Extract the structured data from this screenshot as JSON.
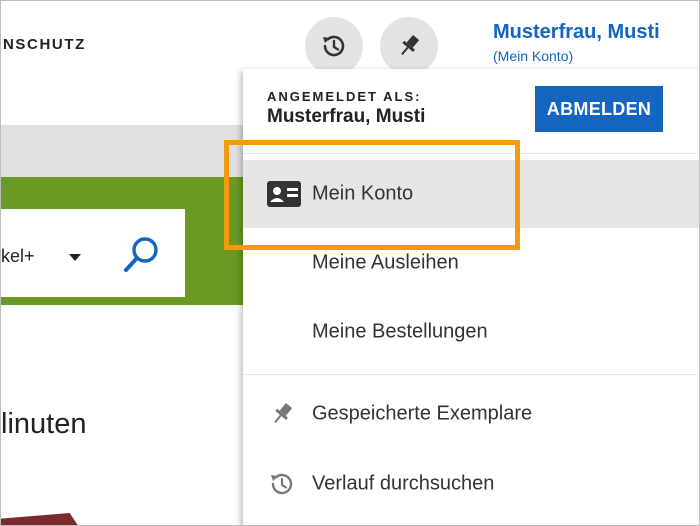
{
  "header": {
    "brand_fragment": "NSCHUTZ",
    "history_button_icon": "history-icon",
    "pin_button_icon": "pin-icon",
    "user_name": "Musterfrau, Musti",
    "account_link": "(Mein Konto)"
  },
  "search": {
    "type_fragment": "kel+",
    "search_icon": "search-icon"
  },
  "main": {
    "heading_fragment": "linuten"
  },
  "account_menu": {
    "signed_in_label": "ANGEMELDET ALS:",
    "signed_in_name": "Musterfrau, Musti",
    "logout_label": "ABMELDEN",
    "items": [
      {
        "label": "Mein Konto",
        "icon": "id-card-icon",
        "active": true
      },
      {
        "label": "Meine Ausleihen",
        "icon": "",
        "active": false
      },
      {
        "label": "Meine Bestellungen",
        "icon": "",
        "active": false
      },
      {
        "label": "Gespeicherte Exemplare",
        "icon": "pin-icon",
        "active": false
      },
      {
        "label": "Verlauf durchsuchen",
        "icon": "history-icon",
        "active": false
      }
    ]
  },
  "colors": {
    "accent_blue": "#1565c0",
    "highlight_orange": "#f49a12",
    "banner_green": "#6a9a23"
  }
}
